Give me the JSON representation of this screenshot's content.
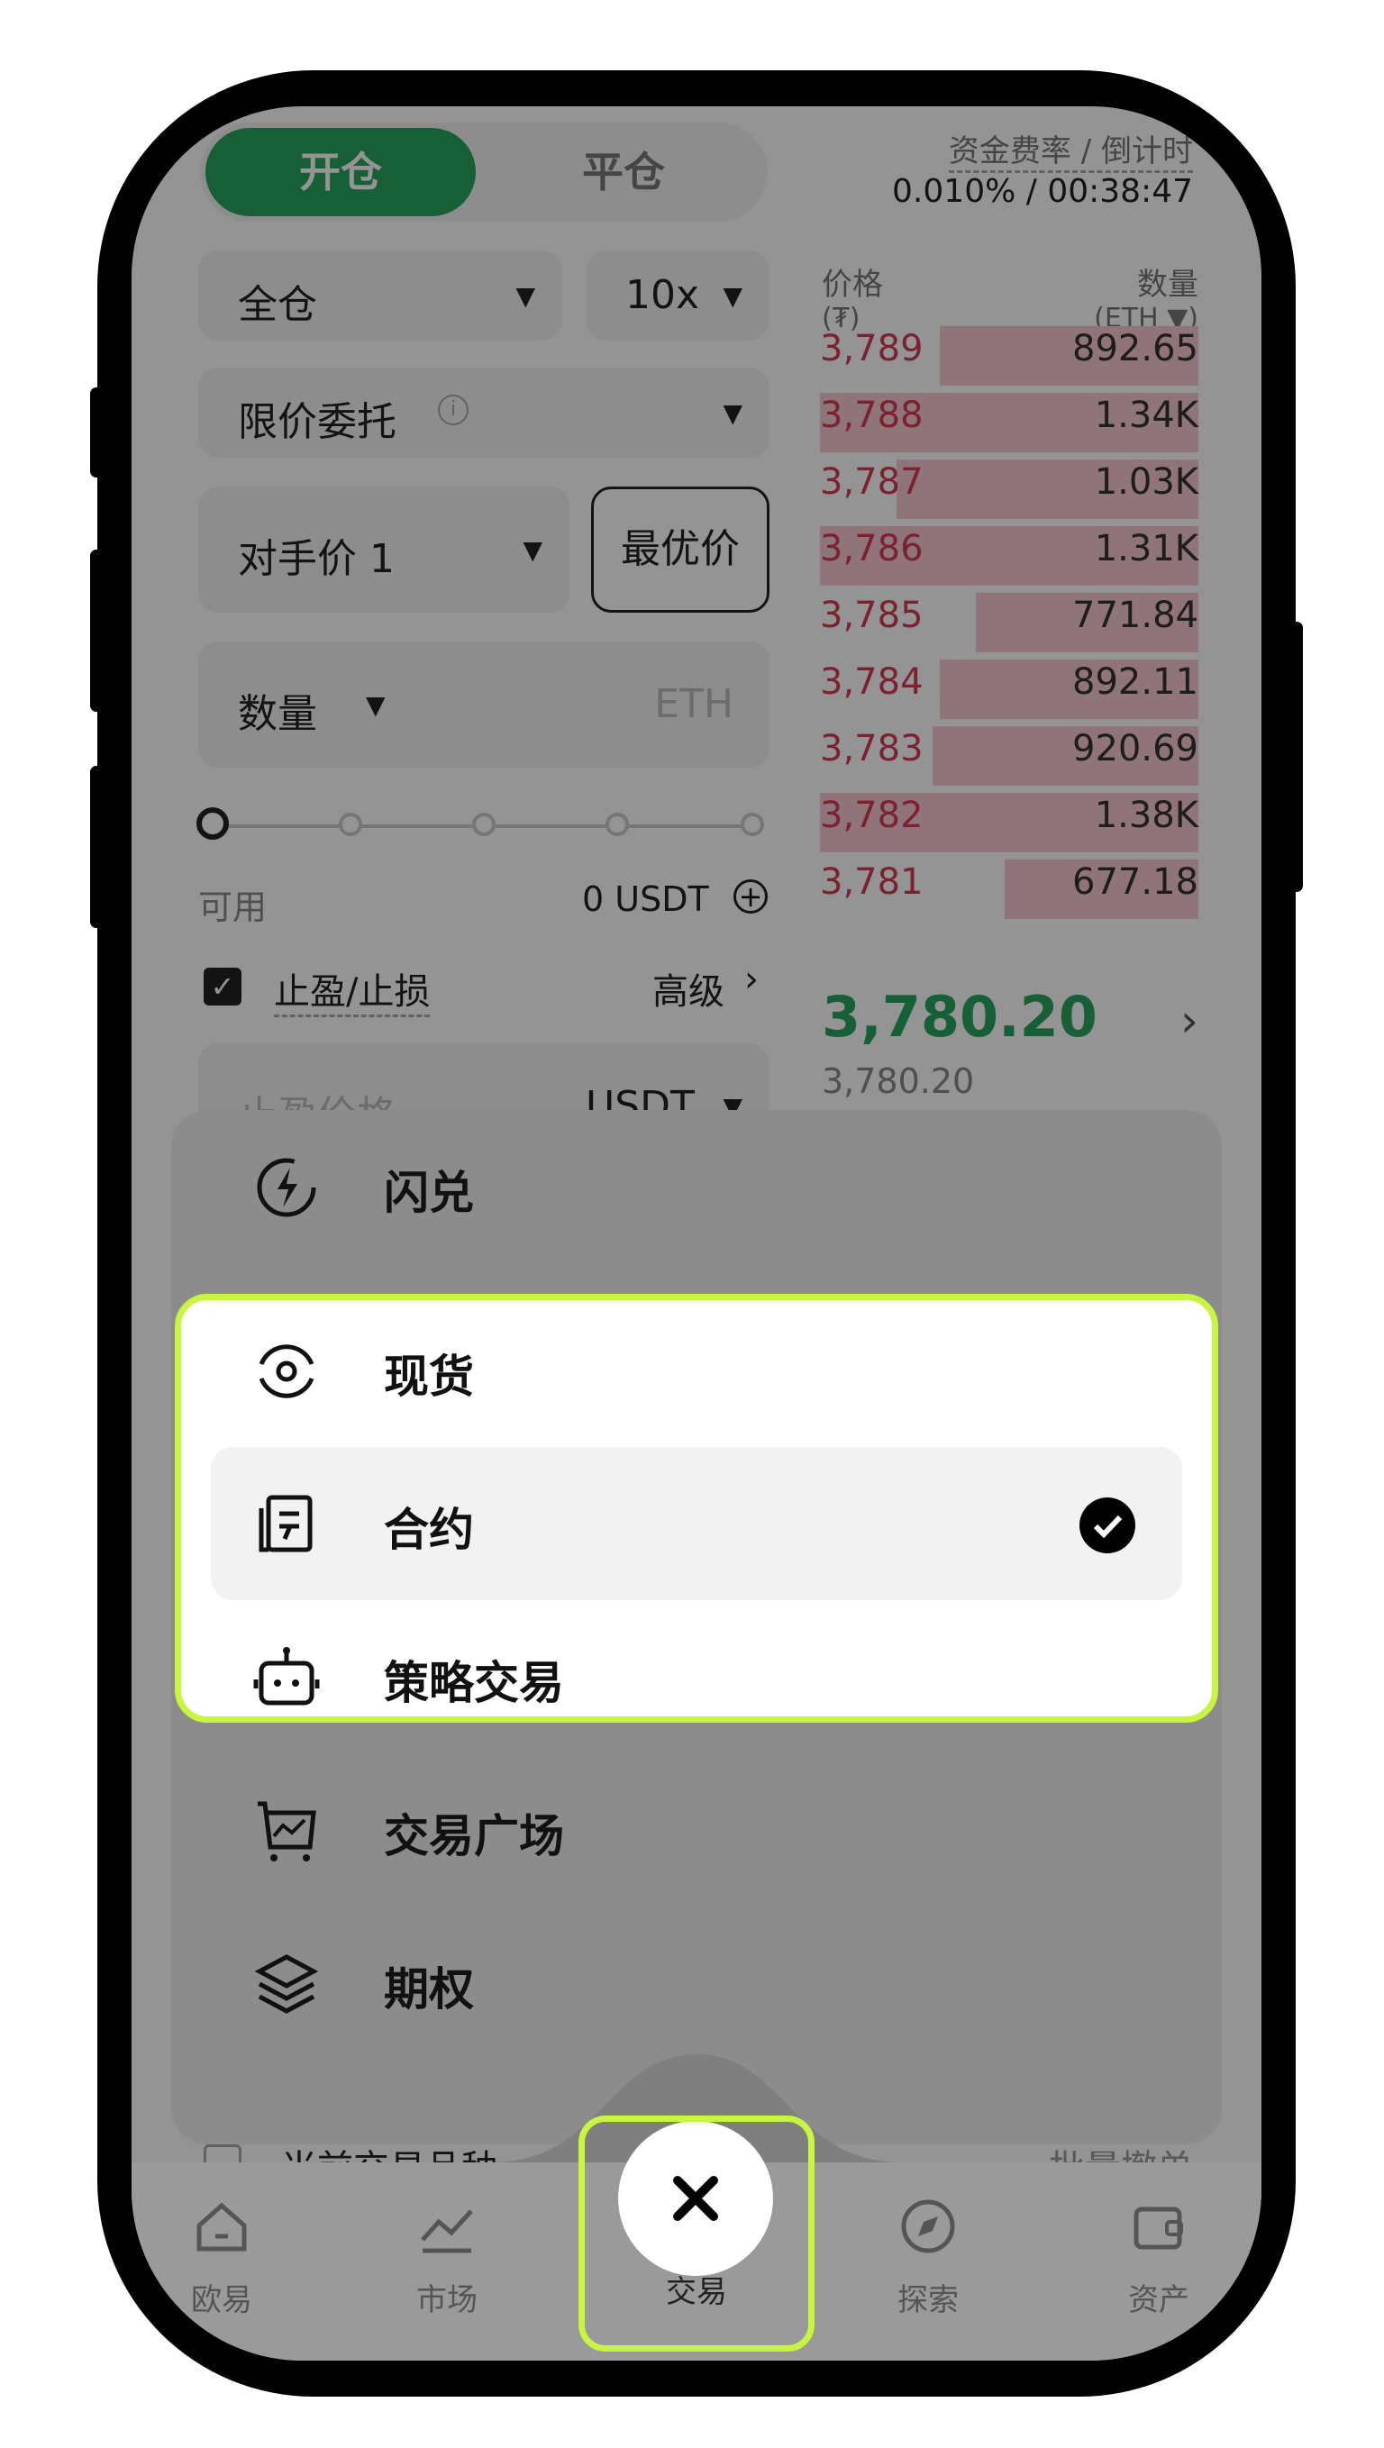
{
  "trade": {
    "toggle_open": "开仓",
    "toggle_close": "平仓",
    "funding_label": "资金费率 / 倒计时",
    "funding_value": "0.010% / 00:38:47",
    "margin_mode": "全仓",
    "leverage": "10x",
    "order_type": "限价委托",
    "price_mode": "对手价 1",
    "best_price_btn": "最优价",
    "qty_label": "数量",
    "qty_unit": "ETH",
    "available_label": "可用",
    "available_value": "0 USDT",
    "tpsl_label": "止盈/止损",
    "advanced_label": "高级",
    "tp_price_placeholder": "止盈价格",
    "tp_unit": "USDT",
    "current_pair_label": "当前交易品种",
    "batch_cancel_label": "批量撤单"
  },
  "orderbook": {
    "price_header": "价格",
    "price_unit": "(₮)",
    "qty_header": "数量",
    "qty_unit": "(ETH ▼)",
    "rows": [
      {
        "price": "3,789",
        "qty": "892.65",
        "depth": 0.36
      },
      {
        "price": "3,788",
        "qty": "1.34K",
        "depth": 0.55
      },
      {
        "price": "3,787",
        "qty": "1.03K",
        "depth": 0.42
      },
      {
        "price": "3,786",
        "qty": "1.31K",
        "depth": 0.54
      },
      {
        "price": "3,785",
        "qty": "771.84",
        "depth": 0.31
      },
      {
        "price": "3,784",
        "qty": "892.11",
        "depth": 0.36
      },
      {
        "price": "3,783",
        "qty": "920.69",
        "depth": 0.37
      },
      {
        "price": "3,782",
        "qty": "1.38K",
        "depth": 0.56
      },
      {
        "price": "3,781",
        "qty": "677.18",
        "depth": 0.27
      }
    ],
    "last_price": "3,780.20",
    "mark_price": "3,780.20"
  },
  "menu": {
    "items": [
      {
        "label": "闪兑",
        "icon": "flash-swap-icon"
      },
      {
        "label": "现货",
        "icon": "spot-icon"
      },
      {
        "label": "合约",
        "icon": "contract-icon",
        "selected": true
      },
      {
        "label": "策略交易",
        "icon": "bot-icon"
      },
      {
        "label": "交易广场",
        "icon": "trade-square-icon"
      },
      {
        "label": "期权",
        "icon": "layers-icon"
      }
    ]
  },
  "nav": {
    "items": [
      {
        "label": "欧易",
        "icon": "home-icon"
      },
      {
        "label": "市场",
        "icon": "chart-icon"
      },
      {
        "label": "交易",
        "icon": "close-icon"
      },
      {
        "label": "探索",
        "icon": "compass-icon"
      },
      {
        "label": "资产",
        "icon": "wallet-icon"
      }
    ]
  },
  "colors": {
    "accent_green": "#28a55f",
    "ask_red": "#d63a52",
    "highlight_lime": "#c8f542"
  }
}
